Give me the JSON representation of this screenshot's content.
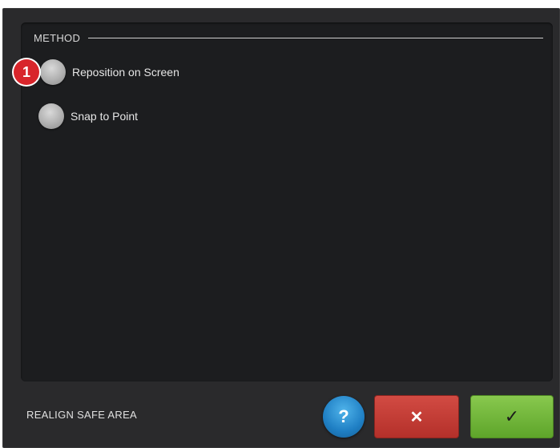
{
  "method": {
    "title": "METHOD",
    "options": [
      {
        "label": "Reposition on Screen"
      },
      {
        "label": "Snap to Point"
      }
    ]
  },
  "badge": "1",
  "footer": {
    "title": "REALIGN SAFE AREA",
    "help_glyph": "?",
    "cancel_glyph": "✕",
    "ok_glyph": "✓"
  },
  "colors": {
    "window_bg": "#2a2a2c",
    "panel_bg": "#1c1d1f",
    "badge": "#d8252b",
    "help_button": "#1f7fc4",
    "cancel_button": "#c23b34",
    "ok_button": "#6db336"
  }
}
